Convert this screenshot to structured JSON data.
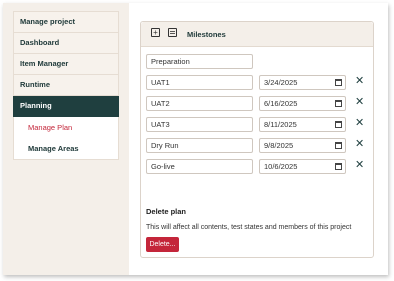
{
  "sidebar": {
    "items": [
      {
        "label": "Manage project"
      },
      {
        "label": "Dashboard"
      },
      {
        "label": "Item Manager"
      },
      {
        "label": "Runtime"
      },
      {
        "label": "Planning"
      }
    ],
    "sub_items": [
      {
        "label": "Manage Plan",
        "selected": true
      },
      {
        "label": "Manage Areas",
        "selected": false
      }
    ]
  },
  "milestones": {
    "title": "Milestones",
    "add_icon": "plus-square-icon",
    "calendar_icon": "calendar-icon",
    "rows": [
      {
        "name": "Preparation",
        "date": ""
      },
      {
        "name": "UAT1",
        "date": "3/24/2025"
      },
      {
        "name": "UAT2",
        "date": "6/16/2025"
      },
      {
        "name": "UAT3",
        "date": "8/11/2025"
      },
      {
        "name": "Dry Run",
        "date": "9/8/2025"
      },
      {
        "name": "Go-live",
        "date": "10/6/2025"
      }
    ]
  },
  "delete_plan": {
    "title": "Delete plan",
    "description": "This will affect all contents, test states and members of this project",
    "button_label": "Delete..."
  },
  "colors": {
    "accent": "#1f3f3f",
    "danger": "#c4263a",
    "background": "#f4efe9"
  }
}
